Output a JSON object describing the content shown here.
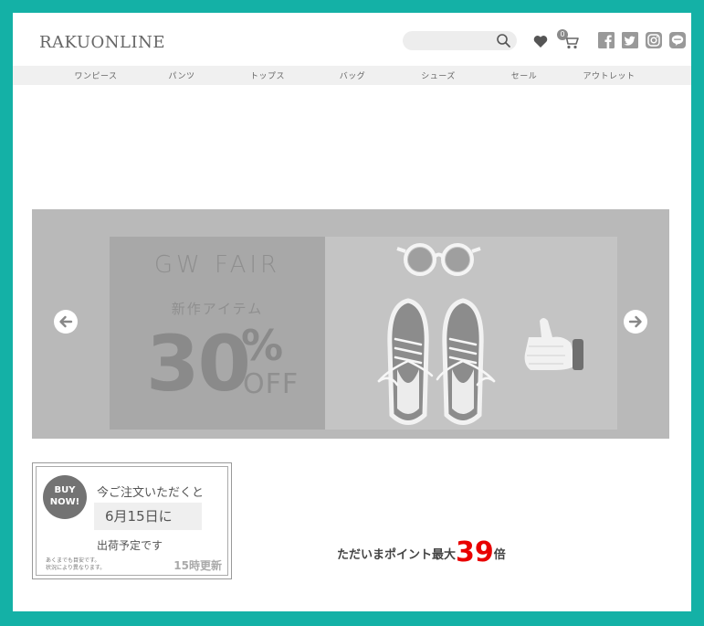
{
  "header": {
    "logo": "RAKUONLINE",
    "search_placeholder": "",
    "cart_count": "0",
    "icons": [
      "search-icon",
      "heart-icon",
      "cart-icon",
      "facebook-icon",
      "twitter-icon",
      "instagram-icon",
      "line-icon"
    ]
  },
  "nav": {
    "items": [
      "ワンピース",
      "パンツ",
      "トップス",
      "バッグ",
      "シューズ",
      "セール",
      "アウトレット"
    ]
  },
  "banner": {
    "title": "GW FAIR",
    "subtitle": "新作アイテム",
    "discount_number": "30",
    "discount_percent": "%",
    "discount_off": "OFF"
  },
  "shipping": {
    "badge_line1": "BUY",
    "badge_line2": "NOW!",
    "line1": "今ご注文いただくと",
    "date": "6月15日に",
    "line3": "出荷予定です",
    "note_line1": "あくまでも目安です。",
    "note_line2": "状況により異なります。",
    "update": "15時更新"
  },
  "points": {
    "prefix": "ただいまポイント最大",
    "number": "39",
    "suffix": "倍"
  },
  "colors": {
    "frame": "#14b1a6",
    "accent_red": "#e80000"
  }
}
